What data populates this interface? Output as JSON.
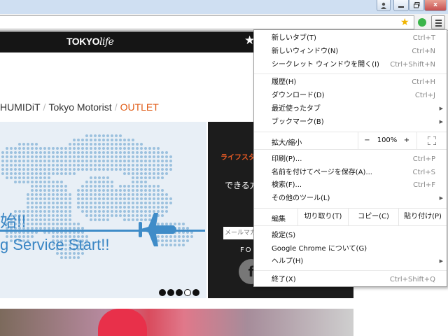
{
  "window": {
    "close_glyph": "x"
  },
  "page": {
    "logo_main": "TOKYO",
    "logo_italic": "life",
    "breadcrumb": {
      "item1": "HUMIDiT",
      "item2": "Tokyo Motorist",
      "item3": "OUTLET",
      "separator": "/"
    },
    "hero": {
      "line1": "始!!",
      "line2": "g Service Start!!"
    },
    "promo": {
      "title": "ライフスタ",
      "subtitle": "できる方",
      "email_placeholder": "メールマガ",
      "follow": "FO",
      "fb": "f"
    },
    "accent_color": "#e05a14"
  },
  "menu": {
    "new_tab": {
      "label": "新しいタブ(T)",
      "shortcut": "Ctrl+T"
    },
    "new_window": {
      "label": "新しいウィンドウ(N)",
      "shortcut": "Ctrl+N"
    },
    "incognito": {
      "label": "シークレット ウィンドウを開く(I)",
      "shortcut": "Ctrl+Shift+N"
    },
    "history": {
      "label": "履歴(H)",
      "shortcut": "Ctrl+H"
    },
    "downloads": {
      "label": "ダウンロード(D)",
      "shortcut": "Ctrl+J"
    },
    "recent_tabs": {
      "label": "最近使ったタブ"
    },
    "bookmarks": {
      "label": "ブックマーク(B)"
    },
    "zoom": {
      "label": "拡大/縮小",
      "minus": "−",
      "value": "100%",
      "plus": "+"
    },
    "print": {
      "label": "印刷(P)...",
      "shortcut": "Ctrl+P"
    },
    "save_page": {
      "label": "名前を付けてページを保存(A)...",
      "shortcut": "Ctrl+S"
    },
    "find": {
      "label": "検索(F)...",
      "shortcut": "Ctrl+F"
    },
    "more_tools": {
      "label": "その他のツール(L)"
    },
    "edit": {
      "label": "編集",
      "cut": "切り取り(T)",
      "copy": "コピー(C)",
      "paste": "貼り付け(P)"
    },
    "settings": {
      "label": "設定(S)"
    },
    "about": {
      "label": "Google Chrome について(G)"
    },
    "help": {
      "label": "ヘルプ(H)"
    },
    "exit": {
      "label": "終了(X)",
      "shortcut": "Ctrl+Shift+Q"
    }
  }
}
